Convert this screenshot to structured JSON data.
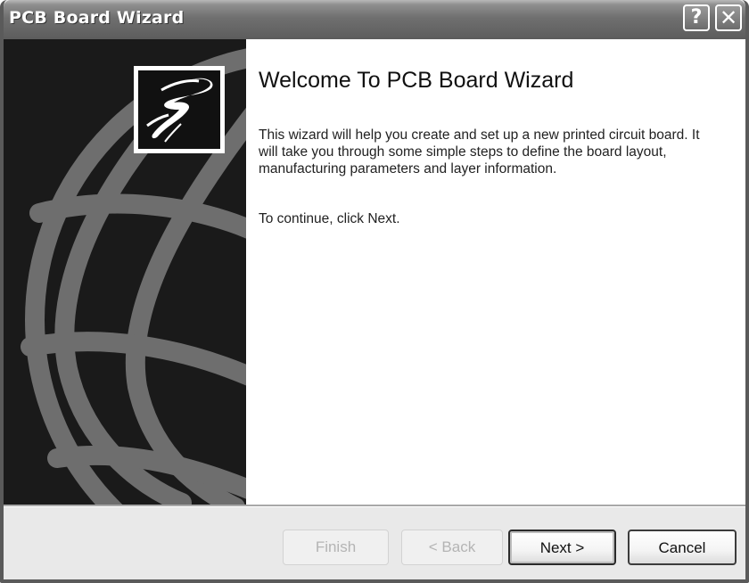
{
  "window": {
    "title": "PCB Board Wizard",
    "help_glyph": "?",
    "close_glyph": "✕"
  },
  "sidebar": {
    "logo_icon": "wizard-lightning-logo",
    "background_icon": "globe-graphic"
  },
  "content": {
    "heading": "Welcome To PCB Board Wizard",
    "description": "This wizard will help you create and set up a new printed circuit board. It will take you through some simple steps to define the board layout, manufacturing parameters and layer information.",
    "continue_hint": "To continue, click Next."
  },
  "footer": {
    "finish_label": "Finish",
    "back_label": "< Back",
    "next_label": "Next >",
    "cancel_label": "Cancel"
  },
  "colors": {
    "titlebar": "#6f6f6f",
    "sidebar": "#1a1a1a",
    "globe_lines": "#6e6e6e",
    "content_bg": "#ffffff",
    "footer_bg": "#e9e9e9"
  }
}
